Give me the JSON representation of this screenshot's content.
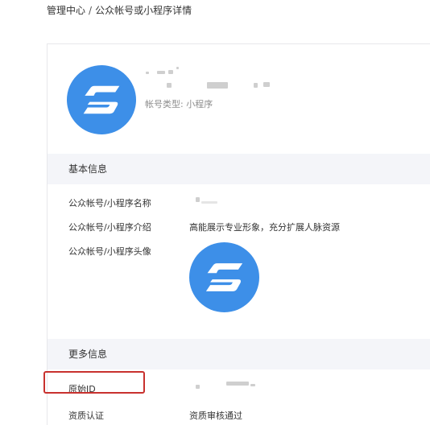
{
  "breadcrumb": {
    "root": "管理中心",
    "separator": "/",
    "current": "公众帐号或小程序详情"
  },
  "header": {
    "account_type_label": "帐号类型:",
    "account_type_value": "小程序",
    "logo_icon": "brand-s-logo-icon"
  },
  "basic_info": {
    "title": "基本信息",
    "rows": [
      {
        "label": "公众帐号/小程序名称",
        "value": ""
      },
      {
        "label": "公众帐号/小程序介绍",
        "value": "高能展示专业形象，充分扩展人脉资源"
      },
      {
        "label": "公众帐号/小程序头像",
        "value": ""
      }
    ]
  },
  "more_info": {
    "title": "更多信息",
    "rows": [
      {
        "label": "原始ID",
        "value": ""
      },
      {
        "label": "资质认证",
        "value": "资质审核通过"
      }
    ]
  },
  "colors": {
    "brand_blue": "#3d8fe8",
    "section_bg": "#f4f5f9",
    "highlight_red": "#c8312e"
  }
}
